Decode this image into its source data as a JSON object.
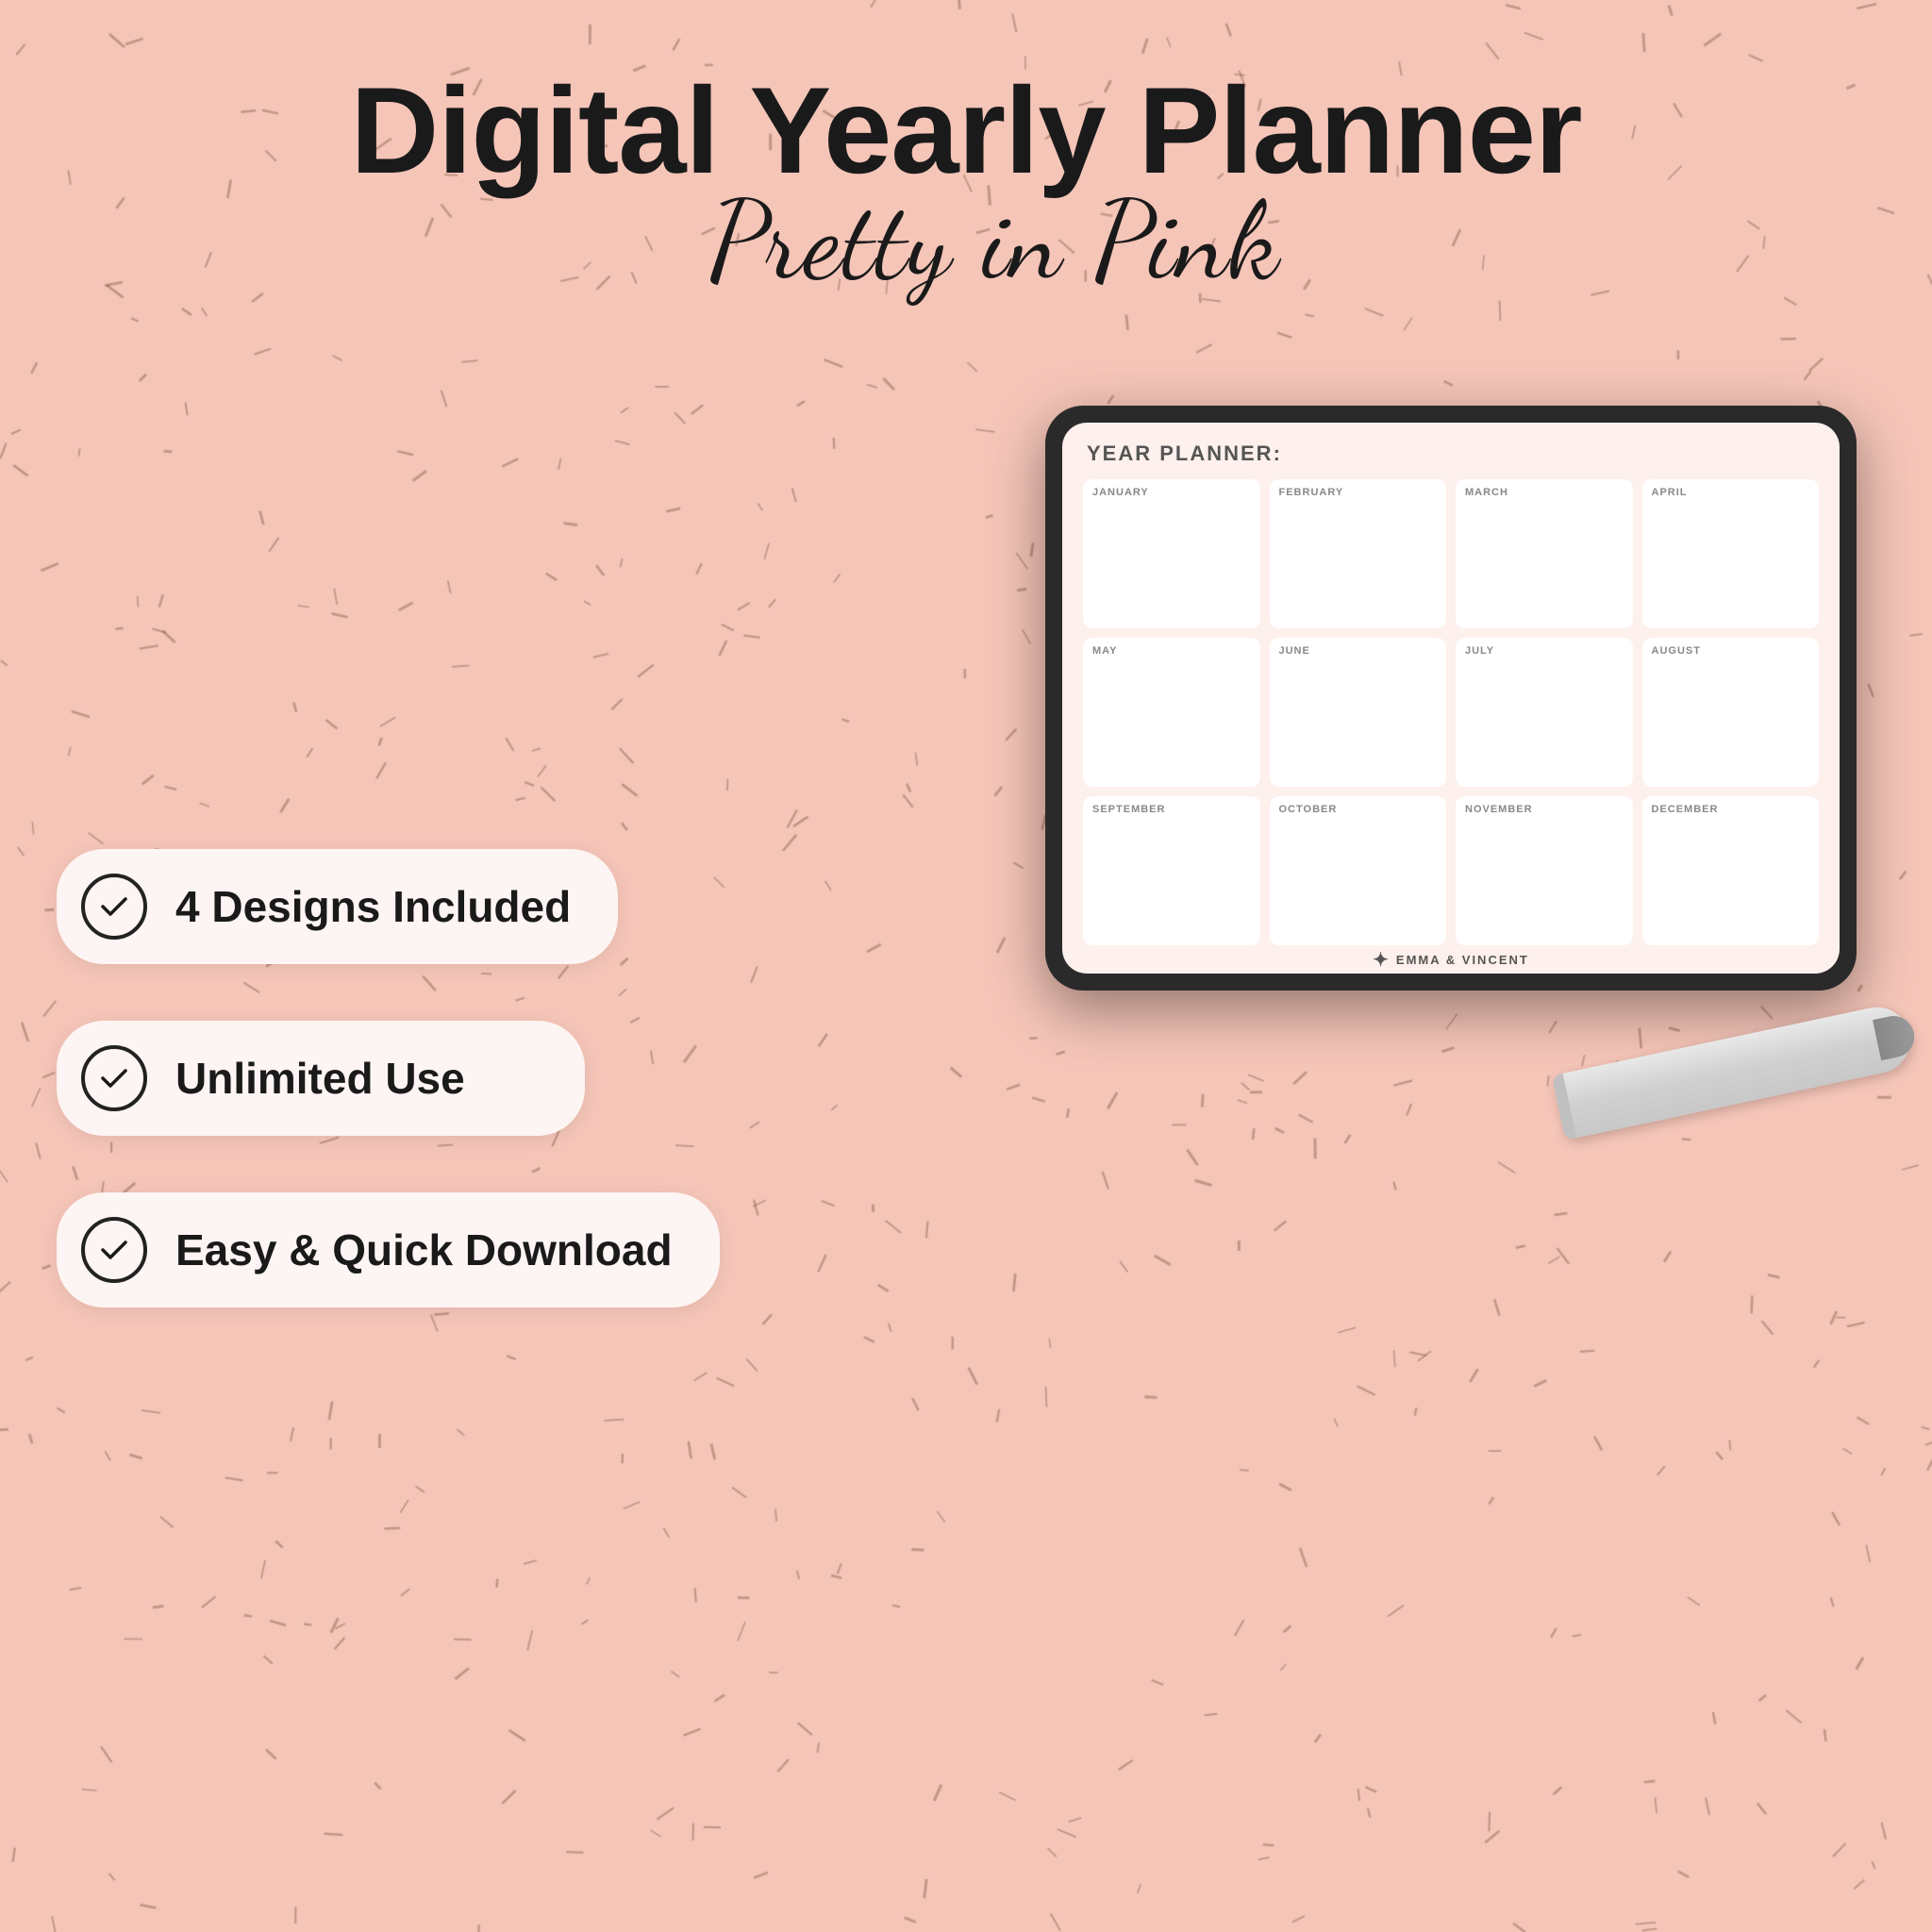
{
  "background": {
    "color": "#f5c5b8"
  },
  "title": {
    "main": "Digital Yearly Planner",
    "script": "Pretty in Pink"
  },
  "tablet": {
    "planner_title": "YEAR PLANNER:",
    "months": [
      "JANUARY",
      "FEBRUARY",
      "MARCH",
      "APRIL",
      "MAY",
      "JUNE",
      "JULY",
      "AUGUST",
      "SEPTEMBER",
      "OCTOBER",
      "NOVEMBER",
      "DECEMBER"
    ],
    "brand": "EMMA & VINCENT"
  },
  "features": [
    {
      "id": "designs",
      "text": "4 Designs Included",
      "icon": "checkmark"
    },
    {
      "id": "unlimited",
      "text": "Unlimited Use",
      "icon": "checkmark"
    },
    {
      "id": "download",
      "text": "Easy & Quick Download",
      "icon": "checkmark"
    }
  ]
}
